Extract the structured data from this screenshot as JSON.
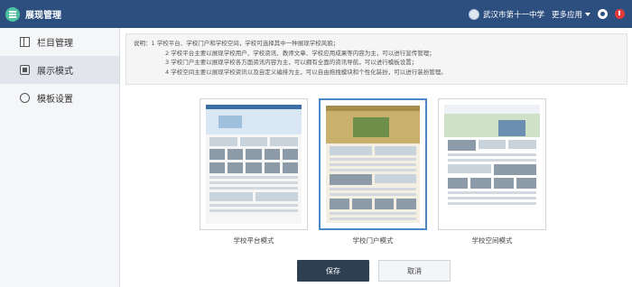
{
  "app": {
    "title": "展现管理"
  },
  "topbar": {
    "school_name": "武汉市第十一中学",
    "more_apps_label": "更多应用"
  },
  "sidebar": {
    "items": [
      {
        "label": "栏目管理",
        "icon": "menu-icon",
        "active": false
      },
      {
        "label": "展示模式",
        "icon": "display-icon",
        "active": true
      },
      {
        "label": "模板设置",
        "icon": "template-icon",
        "active": false
      }
    ]
  },
  "note": {
    "line1": "说明：1 学校平台、学校门户和学校空间，学校可选择其中一种展现学校风貌；",
    "line2": "2 学校平台主要以展现学校用户、学校资讯、教师文章、学校应用成果等内容为主，可以进行宣传管理；",
    "line3": "3 学校门户主要以展现学校各方面资讯内容为主，可以拥有全面的资讯导航，可以进行模板设置；",
    "line4": "4 学校空间主要以展现学校资讯以及自定义编排为主，可以自由拖拽模块和个性化装扮，可以进行装扮管理。"
  },
  "templates": [
    {
      "label": "学校平台模式",
      "selected": false
    },
    {
      "label": "学校门户模式",
      "selected": true
    },
    {
      "label": "学校空间模式",
      "selected": false
    }
  ],
  "actions": {
    "save_label": "保存",
    "cancel_label": "取消"
  },
  "colors": {
    "topbar": "#2d4f7f",
    "accent": "#4a88c7",
    "save_button": "#2e3f52"
  }
}
